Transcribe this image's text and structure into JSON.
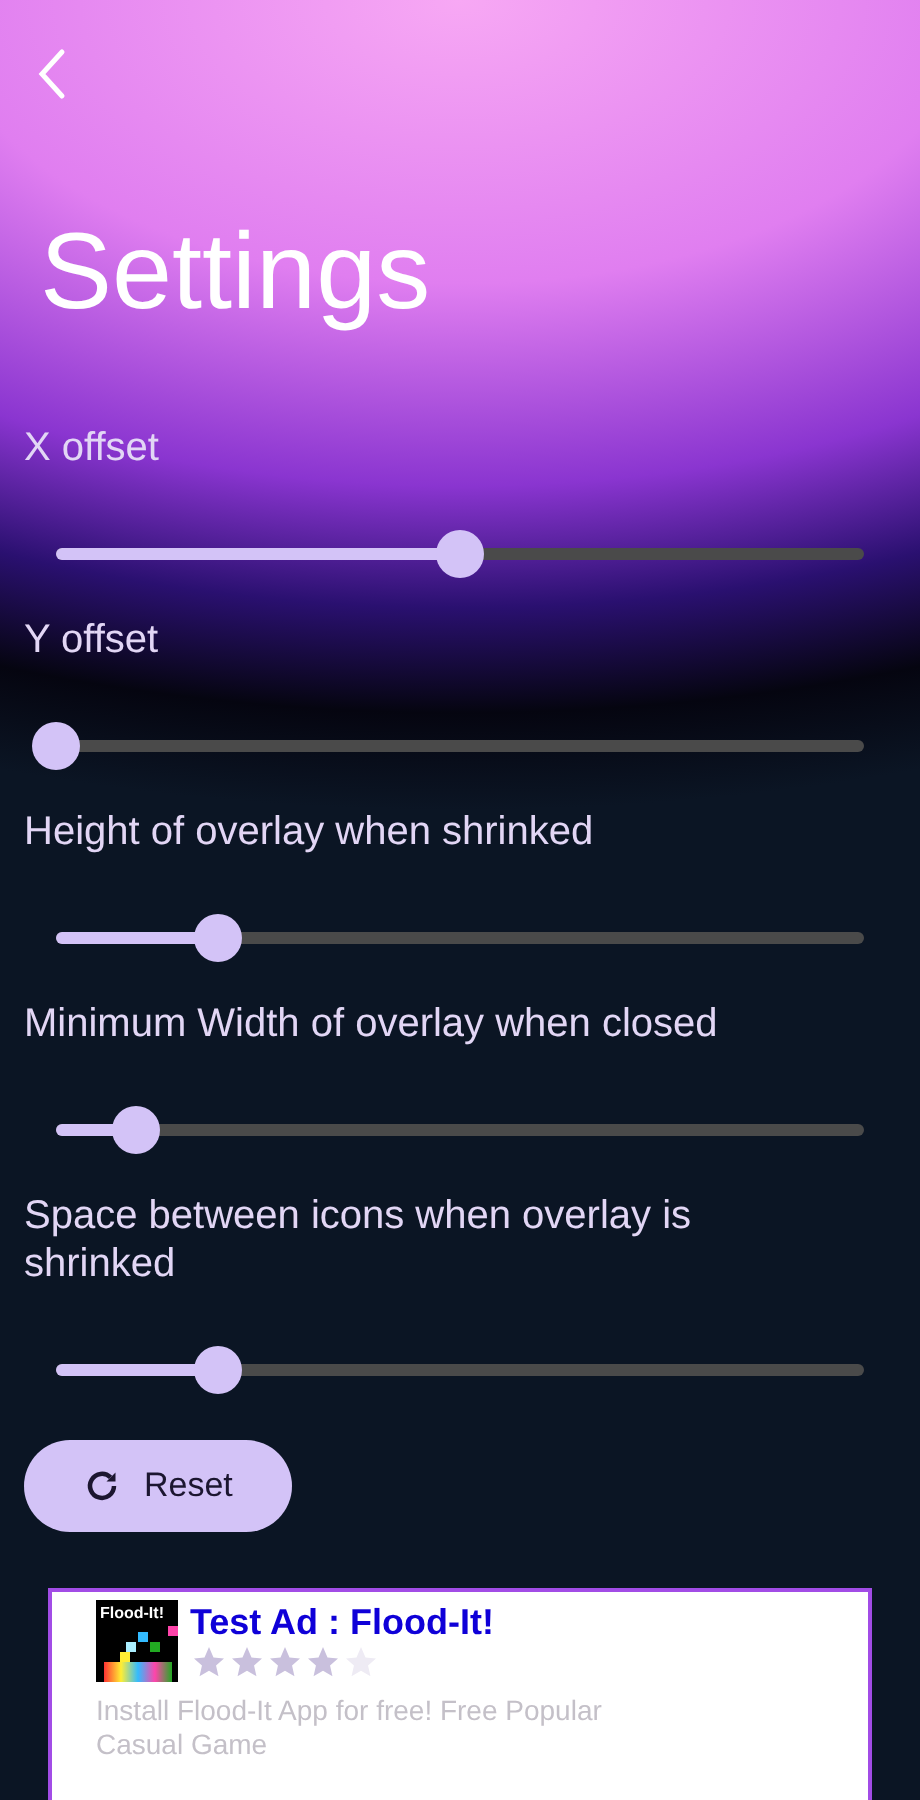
{
  "header": {
    "title": "Settings"
  },
  "sliders": [
    {
      "label": "X offset",
      "level": 0.5
    },
    {
      "label": "Y offset",
      "level": 0
    },
    {
      "label": "Height of overlay when shrinked",
      "level": 0.2
    },
    {
      "label": "Minimum Width of overlay when closed",
      "level": 0.1
    },
    {
      "label": "Space between icons when overlay is shrinked",
      "level": 0.2
    }
  ],
  "reset_button": {
    "label": "Reset"
  },
  "ad": {
    "icon_text": "Flood-It!",
    "title": "Test Ad : Flood-It!",
    "stars": 4,
    "description": "Install Flood-It App for free! Free Popular Casual Game"
  }
}
